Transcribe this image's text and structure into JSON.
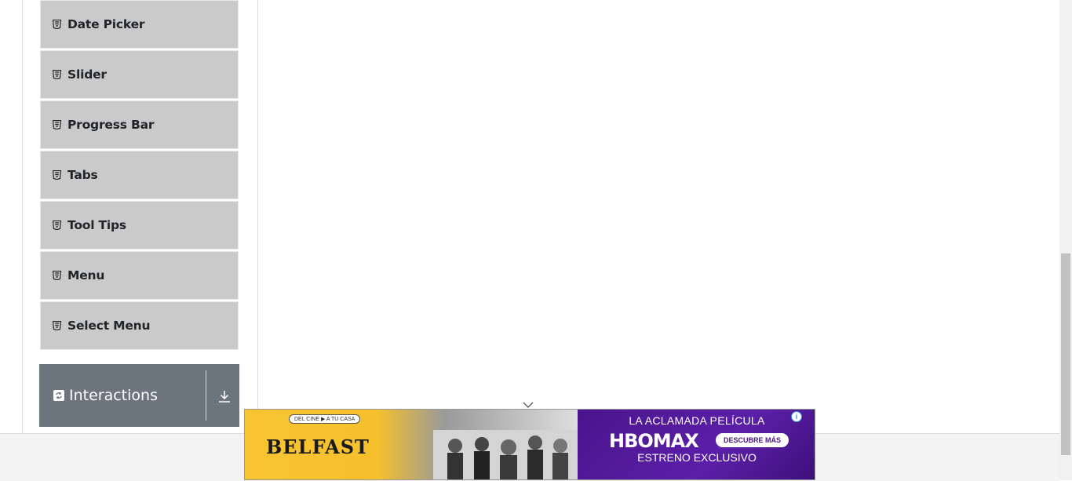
{
  "sidebar": {
    "items": [
      {
        "label": "Date Picker"
      },
      {
        "label": "Slider"
      },
      {
        "label": "Progress Bar"
      },
      {
        "label": "Tabs"
      },
      {
        "label": "Tool Tips"
      },
      {
        "label": "Menu"
      },
      {
        "label": "Select Menu"
      }
    ],
    "group": {
      "label": "Interactions"
    }
  },
  "ad": {
    "tag": "DEL CINE ▶ A TU CASA",
    "title": "BELFAST",
    "headline": "LA ACLAMADA PELÍCULA",
    "logo": "HBOMAX",
    "cta": "DESCUBRE MÁS",
    "subline": "ESTRENO EXCLUSIVO",
    "info": "i"
  },
  "colors": {
    "menu_bg": "#cacaca",
    "group_bg": "#6c757d",
    "ad_purple": "#4a148c",
    "ad_yellow": "#f7c531"
  }
}
